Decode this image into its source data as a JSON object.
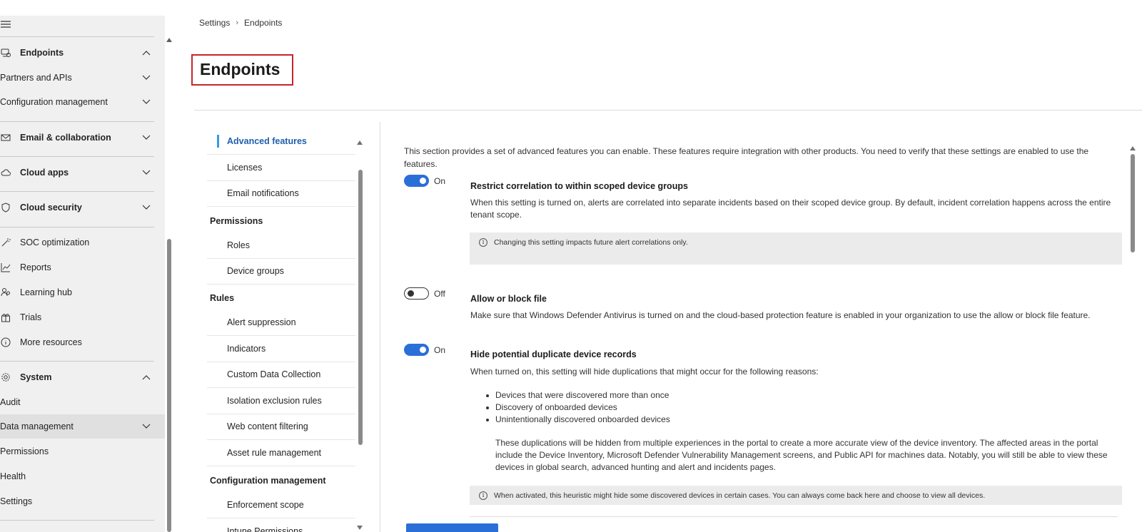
{
  "leftnav": {
    "items": [
      {
        "label": "Endpoints",
        "icon": "endpoint-icon",
        "expanded": true
      },
      {
        "label": "Partners and APIs"
      },
      {
        "label": "Configuration management"
      },
      {
        "label": "Email & collaboration",
        "icon": "mail-icon"
      },
      {
        "label": "Cloud apps",
        "icon": "cloud-icon"
      },
      {
        "label": "Cloud security",
        "icon": "shield-cloud-icon"
      },
      {
        "label": "SOC optimization",
        "icon": "wand-icon"
      },
      {
        "label": "Reports",
        "icon": "chart-icon"
      },
      {
        "label": "Learning hub",
        "icon": "people-icon"
      },
      {
        "label": "Trials",
        "icon": "gift-icon"
      },
      {
        "label": "More resources",
        "icon": "info-icon"
      },
      {
        "label": "System",
        "icon": "gear-icon",
        "expanded": true
      },
      {
        "label": "Audit"
      },
      {
        "label": "Data management",
        "selected": true
      },
      {
        "label": "Permissions"
      },
      {
        "label": "Health"
      },
      {
        "label": "Settings"
      }
    ]
  },
  "breadcrumb": {
    "root": "Settings",
    "current": "Endpoints"
  },
  "page_title": "Endpoints",
  "midnav": {
    "general": [
      "Advanced features",
      "Licenses",
      "Email notifications"
    ],
    "permissions_head": "Permissions",
    "permissions": [
      "Roles",
      "Device groups"
    ],
    "rules_head": "Rules",
    "rules": [
      "Alert suppression",
      "Indicators",
      "Custom Data Collection",
      "Isolation exclusion rules",
      "Web content filtering",
      "Asset rule management"
    ],
    "config_head": "Configuration management",
    "config": [
      "Enforcement scope",
      "Intune Permissions"
    ]
  },
  "content": {
    "intro": "This section provides a set of advanced features you can enable. These features require integration with other products. You need to verify that these settings are enabled to use the features.",
    "restrict": {
      "state": "On",
      "title": "Restrict correlation to within scoped device groups",
      "text": "When this setting is turned on, alerts are correlated into separate incidents based on their scoped device group. By default, incident correlation happens across the entire tenant scope.",
      "info": "Changing this setting impacts future alert correlations only."
    },
    "allow_block": {
      "state": "Off",
      "title": "Allow or block file",
      "text": "Make sure that Windows Defender Antivirus is turned on and the cloud-based protection feature is enabled in your organization to use the allow or block file feature."
    },
    "hide_dup": {
      "state": "On",
      "title": "Hide potential duplicate device records",
      "text": "When turned on, this setting will hide duplications that might occur for the following reasons:",
      "bullets": [
        "Devices that were discovered more than once",
        "Discovery of onboarded devices",
        "Unintentionally discovered onboarded devices"
      ],
      "para": "These duplications will be hidden from multiple experiences in the portal to create a more accurate view of the device inventory. The affected areas in the portal include the Device Inventory, Microsoft Defender Vulnerability Management screens, and Public API for machines data. Notably, you will still be able to view these devices in global search, advanced hunting and alert and incidents pages.",
      "info": "When activated, this heuristic might hide some discovered devices in certain cases. You can always come back here and choose to view all devices."
    }
  }
}
